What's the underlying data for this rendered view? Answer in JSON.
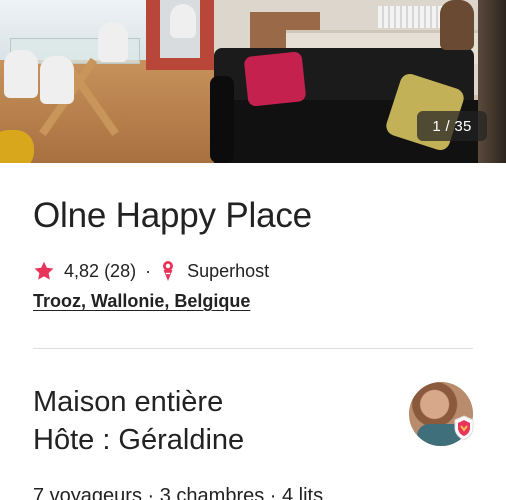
{
  "gallery": {
    "counter": "1 / 35"
  },
  "listing": {
    "title": "Olne Happy Place",
    "rating": "4,82",
    "reviews": "(28)",
    "separator": "·",
    "host_status": "Superhost",
    "location": "Trooz, Wallonie, Belgique"
  },
  "host_section": {
    "property_type": "Maison entière",
    "host_line": "Hôte : Géraldine",
    "capacity": "7 voyageurs · 3 chambres · 4 lits"
  },
  "icons": {
    "rating": "star-icon",
    "superhost": "superhost-badge-icon"
  },
  "colors": {
    "accent": "#e8345a",
    "text": "#222222",
    "divider": "#dddddd"
  }
}
